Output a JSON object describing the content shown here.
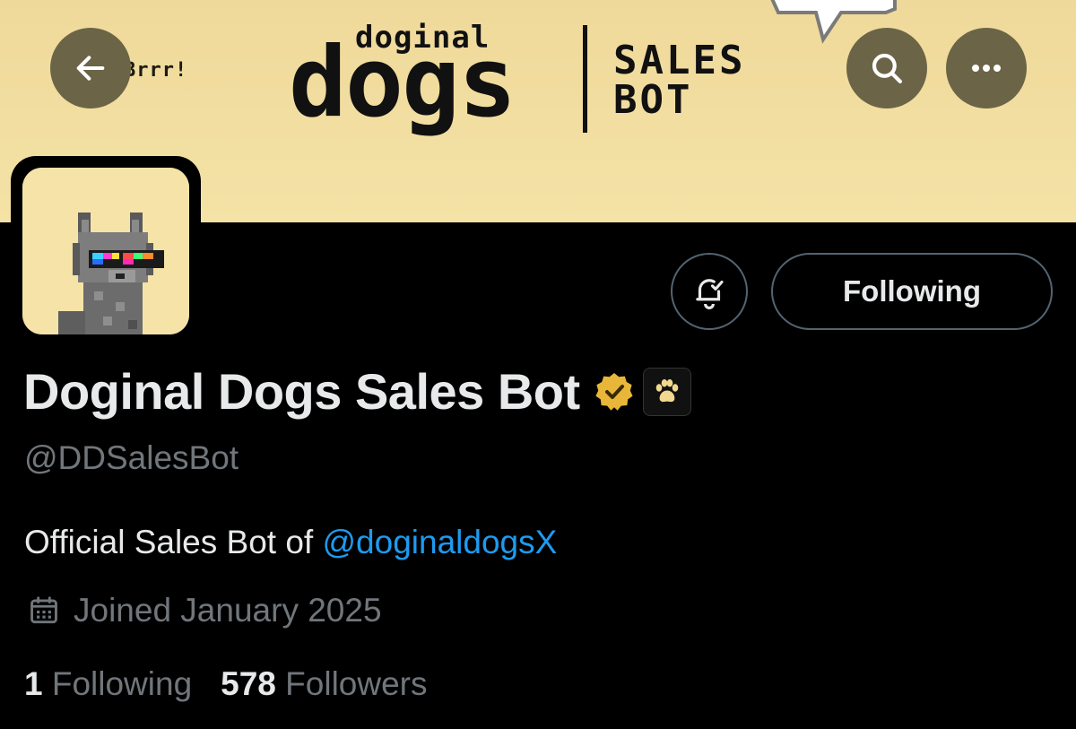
{
  "banner": {
    "speech_text": "Brrr!",
    "logo_small": "doginal",
    "logo_big": "dogs",
    "logo_sales": "SALES",
    "logo_bot": "BOT",
    "bg_color": "#f1dc9e"
  },
  "header": {
    "back_icon": "arrow-left-icon",
    "search_icon": "search-icon",
    "more_icon": "ellipsis-icon"
  },
  "actions": {
    "notify_icon": "bell-check-icon",
    "follow_label": "Following"
  },
  "profile": {
    "display_name": "Doginal Dogs Sales Bot",
    "verified_icon": "gold-verified-badge-icon",
    "affiliate_icon": "paw-icon",
    "handle": "@DDSalesBot",
    "bio_prefix": "Official Sales Bot of ",
    "bio_mention": "@doginaldogsX",
    "joined_icon": "calendar-icon",
    "joined_text": "Joined January 2025",
    "following_count": "1",
    "following_label": "Following",
    "followers_count": "578",
    "followers_label": "Followers"
  },
  "colors": {
    "accent": "#1d9bf0",
    "muted": "#71767b",
    "text": "#e7e9ea",
    "header_button": "#6b6447",
    "verified_gold": "#e8b73a"
  }
}
